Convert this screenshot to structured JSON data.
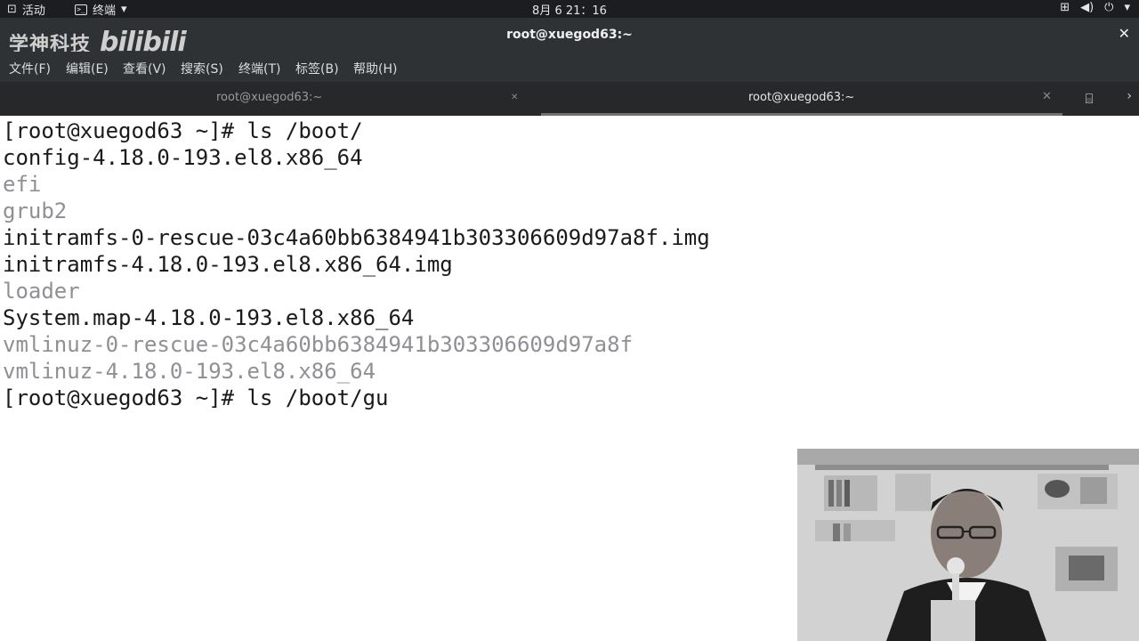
{
  "topbar": {
    "activities": "活动",
    "app_name": "终端",
    "clock": "8月 6  21：16"
  },
  "window": {
    "title": "root@xuegod63:~"
  },
  "watermark": {
    "brand_cn": "学神科技",
    "brand_logo": "bilibili"
  },
  "menu": [
    "文件(F)",
    "编辑(E)",
    "查看(V)",
    "搜索(S)",
    "终端(T)",
    "标签(B)",
    "帮助(H)"
  ],
  "tabs": [
    {
      "label": "root@xuegod63:~",
      "active": false
    },
    {
      "label": "root@xuegod63:~",
      "active": true
    }
  ],
  "terminal": {
    "lines": [
      {
        "text": "[root@xuegod63 ~]# ls /boot/",
        "kind": "normal"
      },
      {
        "text": "config-4.18.0-193.el8.x86_64",
        "kind": "normal"
      },
      {
        "text": "efi",
        "kind": "dir"
      },
      {
        "text": "grub2",
        "kind": "dir"
      },
      {
        "text": "initramfs-0-rescue-03c4a60bb6384941b303306609d97a8f.img",
        "kind": "normal"
      },
      {
        "text": "initramfs-4.18.0-193.el8.x86_64.img",
        "kind": "normal"
      },
      {
        "text": "loader",
        "kind": "dir"
      },
      {
        "text": "System.map-4.18.0-193.el8.x86_64",
        "kind": "normal"
      },
      {
        "text": "vmlinuz-0-rescue-03c4a60bb6384941b303306609d97a8f",
        "kind": "dir"
      },
      {
        "text": "vmlinuz-4.18.0-193.el8.x86_64",
        "kind": "dir"
      },
      {
        "text": "[root@xuegod63 ~]# ls /boot/gu",
        "kind": "normal"
      }
    ]
  },
  "colors": {
    "topbar_bg": "#1b1d1f",
    "titlebar_bg": "#2f3234",
    "tab_bg": "#262829",
    "terminal_bg": "#ffffff",
    "terminal_fg": "#1a1a1a",
    "dir_fg": "#8e9096"
  },
  "icons": {
    "app": "terminal-icon",
    "app_menu": "chevron-down-icon",
    "tray": [
      "network-icon",
      "volume-icon",
      "power-icon",
      "chevron-down-icon"
    ],
    "window_close": "close-icon",
    "tab_close": "close-icon",
    "tab_menu": "new-tab-icon",
    "tab_scroll": "chevron-right-icon"
  }
}
